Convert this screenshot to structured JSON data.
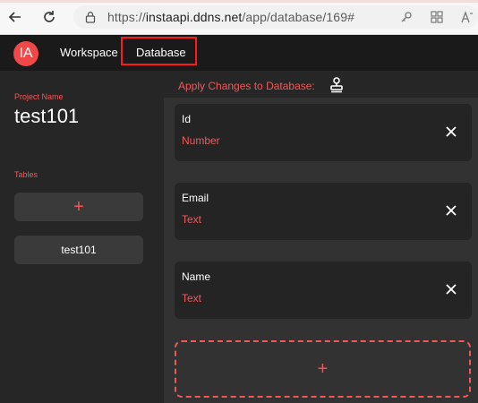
{
  "browser": {
    "url_prefix": "https://",
    "url_host": "instaapi.ddns.net",
    "url_path": "/app/database/169#"
  },
  "header": {
    "logo": "IA",
    "nav": [
      "Workspace",
      "Database"
    ],
    "active_nav": "Database"
  },
  "sidebar": {
    "project_label": "Project Name",
    "project_name": "test101",
    "tables_label": "Tables",
    "add_table": "+",
    "tables": [
      "test101"
    ]
  },
  "main": {
    "apply_label": "Apply Changes to Database:",
    "fields": [
      {
        "name": "Id",
        "type": "Number"
      },
      {
        "name": "Email",
        "type": "Text"
      },
      {
        "name": "Name",
        "type": "Text"
      }
    ],
    "add_field": "+"
  },
  "colors": {
    "accent": "#f05858",
    "highlight": "#ff1a1a"
  }
}
